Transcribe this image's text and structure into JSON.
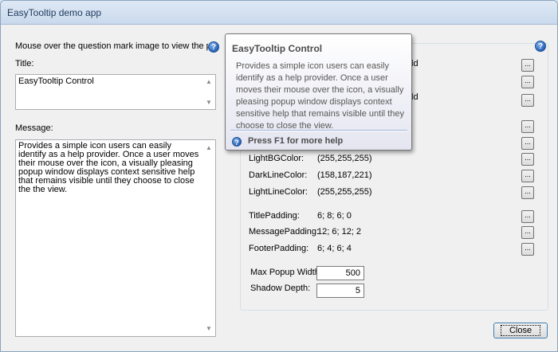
{
  "window": {
    "title": "EasyTooltip demo app"
  },
  "left": {
    "instruction": "Mouse over the question mark image to view the popup",
    "title_label": "Title:",
    "title_value": "EasyTooltip Control",
    "message_label": "Message:",
    "message_value": "Provides a simple icon users can easily identify as a help provider. Once a user moves their mouse over the icon, a visually pleasing popup window displays context sensitive help that remains visible until they choose to close the the view."
  },
  "properties": {
    "partial_values": [
      "ld",
      "ld"
    ],
    "colors": [
      {
        "label": "LightBGColor:",
        "value": "(255,255,255)"
      },
      {
        "label": "DarkLineColor:",
        "value": "(158,187,221)"
      },
      {
        "label": "LightLineColor:",
        "value": "(255,255,255)"
      }
    ],
    "paddings": [
      {
        "label": "TitlePadding:",
        "value": "6; 8; 6; 0"
      },
      {
        "label": "MessagePadding:",
        "value": "12; 6; 12; 2"
      },
      {
        "label": "FooterPadding:",
        "value": "6; 4; 6; 4"
      }
    ],
    "max_popup_width_label": "Max Popup Width:",
    "max_popup_width_value": "500",
    "shadow_depth_label": "Shadow Depth:",
    "shadow_depth_value": "5",
    "ellipsis_label": "..."
  },
  "popup": {
    "title": "EasyTooltip Control",
    "message": "Provides a simple icon users can easily identify as a help provider. Once a user moves their mouse over the icon, a visually pleasing popup window displays context sensitive help that remains visible until they choose to close the view.",
    "footer": "Press F1 for more help"
  },
  "buttons": {
    "close": "Close"
  },
  "icons": {
    "help": "question-mark-icon",
    "help_glyph": "?",
    "scroll_up": "▲",
    "scroll_down": "▼"
  },
  "colors": {
    "accent": "#2a64b8",
    "popup_line": "#9eb5d9"
  }
}
